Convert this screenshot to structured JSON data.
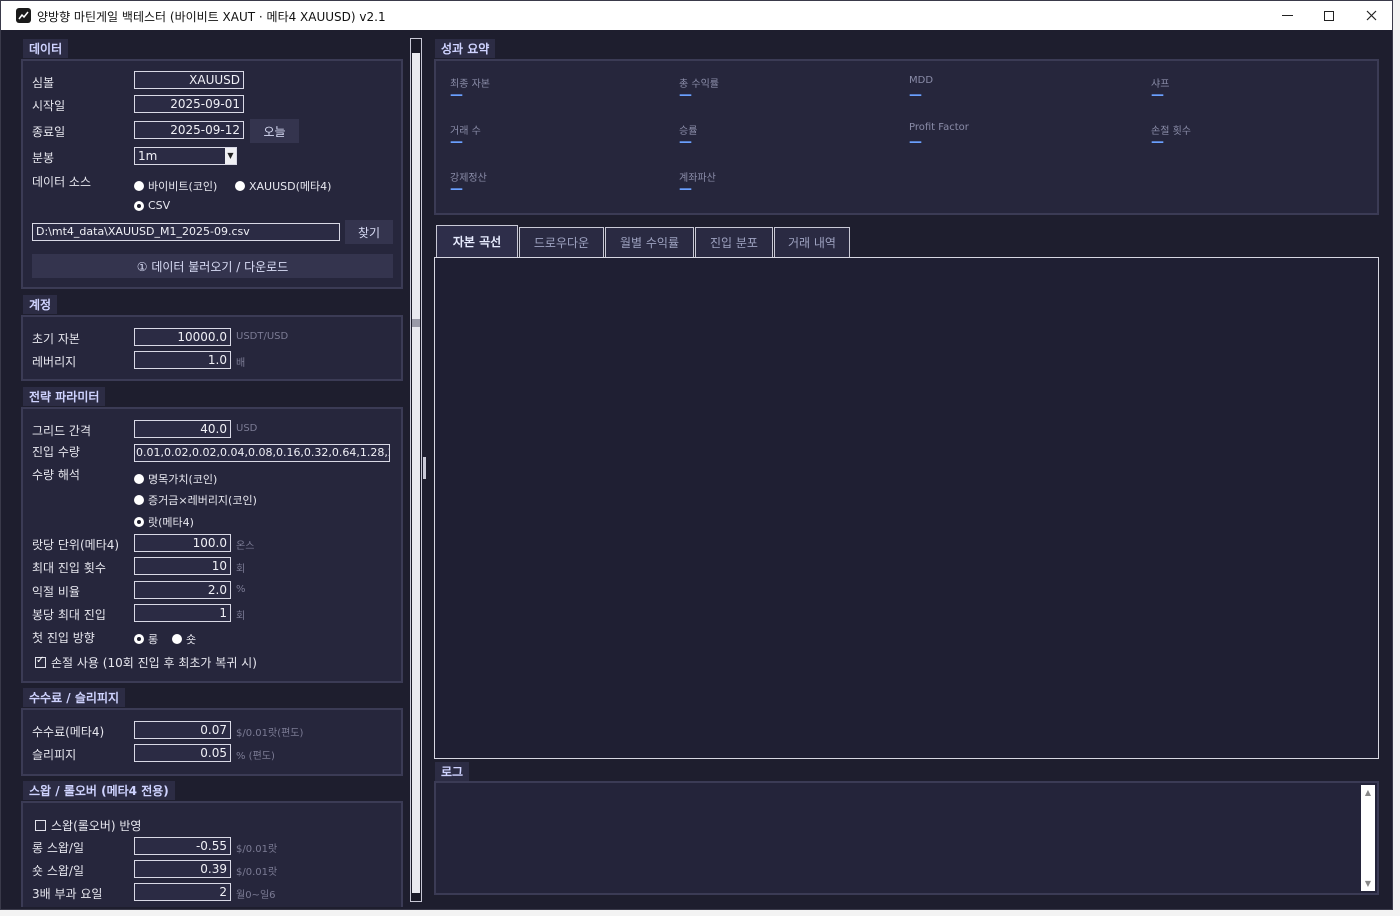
{
  "window": {
    "title": "양방향 마틴게일 백테스터 (바이비트 XAUT · 메타4 XAUUSD) v2.1"
  },
  "data_section": {
    "title": "데이터",
    "symbol_label": "심볼",
    "symbol_value": "XAUUSD",
    "start_label": "시작일",
    "start_value": "2025-09-01",
    "end_label": "종료일",
    "end_value": "2025-09-12",
    "today_button": "오늘",
    "timeframe_label": "분봉",
    "timeframe_value": "1m",
    "source_label": "데이터 소스",
    "source_options": [
      "바이비트(코인)",
      "XAUUSD(메타4)",
      "CSV"
    ],
    "source_selected": "CSV",
    "csv_path": "D:\\mt4_data\\XAUUSD_M1_2025-09.csv",
    "browse_button": "찾기",
    "load_button": "① 데이터 불러오기 / 다운로드"
  },
  "account_section": {
    "title": "계정",
    "capital_label": "초기 자본",
    "capital_value": "10000.0",
    "capital_unit": "USDT/USD",
    "leverage_label": "레버리지",
    "leverage_value": "1.0",
    "leverage_unit": "배"
  },
  "strategy_section": {
    "title": "전략 파라미터",
    "grid_label": "그리드 간격",
    "grid_value": "40.0",
    "grid_unit": "USD",
    "qty_label": "진입 수량",
    "qty_value": "0.01,0.02,0.02,0.04,0.08,0.16,0.32,0.64,1.28,2.56",
    "interp_label": "수량 해석",
    "interp_options": [
      "명목가치(코인)",
      "증거금×레버리지(코인)",
      "랏(메타4)"
    ],
    "interp_selected": "랏(메타4)",
    "lotunit_label": "랏당 단위(메타4)",
    "lotunit_value": "100.0",
    "lotunit_unit": "온스",
    "maxentry_label": "최대 진입 횟수",
    "maxentry_value": "10",
    "maxentry_unit": "회",
    "tp_label": "익절 비율",
    "tp_value": "2.0",
    "tp_unit": "%",
    "perbar_label": "봉당 최대 진입",
    "perbar_value": "1",
    "perbar_unit": "회",
    "firstdir_label": "첫 진입 방향",
    "firstdir_options": [
      "롱",
      "숏"
    ],
    "firstdir_selected": "롱",
    "stoploss_label": "손절 사용 (10회 진입 후 최초가 복귀 시)",
    "stoploss_checked": true
  },
  "fee_section": {
    "title": "수수료 / 슬리피지",
    "fee_label": "수수료(메타4)",
    "fee_value": "0.07",
    "fee_unit": "$/0.01랏(편도)",
    "slip_label": "슬리피지",
    "slip_value": "0.05",
    "slip_unit": "% (편도)"
  },
  "swap_section": {
    "title": "스왑 / 롤오버 (메타4 전용)",
    "apply_label": "스왑(롤오버) 반영",
    "apply_checked": false,
    "long_label": "롱 스왑/일",
    "long_value": "-0.55",
    "long_unit": "$/0.01랏",
    "short_label": "숏 스왑/일",
    "short_value": "0.39",
    "short_unit": "$/0.01랏",
    "triple_label": "3배 부과 요일",
    "triple_value": "2",
    "triple_unit": "월0~일6"
  },
  "summary": {
    "title": "성과 요약",
    "metrics": [
      {
        "label": "최종 자본",
        "value": "—"
      },
      {
        "label": "총 수익률",
        "value": "—"
      },
      {
        "label": "MDD",
        "value": "—"
      },
      {
        "label": "샤프",
        "value": "—"
      },
      {
        "label": "거래 수",
        "value": "—"
      },
      {
        "label": "승률",
        "value": "—"
      },
      {
        "label": "Profit Factor",
        "value": "—"
      },
      {
        "label": "손절 횟수",
        "value": "—"
      },
      {
        "label": "강제정산",
        "value": "—"
      },
      {
        "label": "계좌파산",
        "value": "—"
      }
    ]
  },
  "tabs": [
    "자본 곡선",
    "드로우다운",
    "월별 수익률",
    "진입 분포",
    "거래 내역"
  ],
  "active_tab": "자본 곡선",
  "log": {
    "title": "로그"
  },
  "colors": {
    "background": "#1e1e2e",
    "panel": "#26263c",
    "accent": "#6aa0ff",
    "section_title": "#cfd3ff"
  }
}
